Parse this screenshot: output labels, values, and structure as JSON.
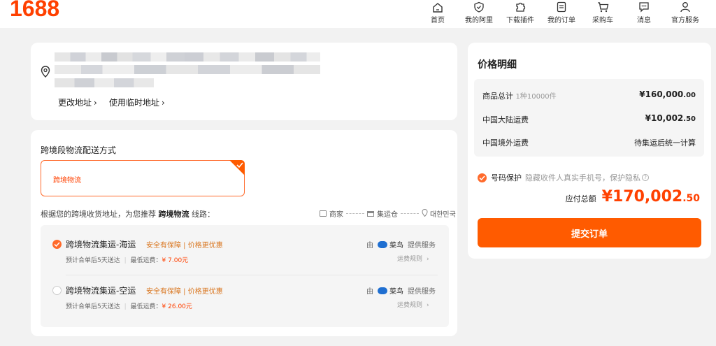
{
  "brand": {
    "logo": "1688",
    "accent": "#ff4000"
  },
  "nav": [
    {
      "label": "首页",
      "icon": "home-icon"
    },
    {
      "label": "我的阿里",
      "icon": "shield-heart-icon"
    },
    {
      "label": "下载插件",
      "icon": "puzzle-icon"
    },
    {
      "label": "我的订单",
      "icon": "order-list-icon"
    },
    {
      "label": "采购车",
      "icon": "cart-icon"
    },
    {
      "label": "消息",
      "icon": "chat-bubble-icon"
    },
    {
      "label": "官方服务",
      "icon": "user-icon"
    }
  ],
  "address": {
    "change_label": "更改地址",
    "temp_label": "使用临时地址"
  },
  "shipping": {
    "section_title": "跨境段物流配送方式",
    "selected_option": "跨境物流",
    "recommend_prefix": "根据您的跨境收货地址，为您推荐",
    "recommend_highlight": "跨境物流",
    "recommend_suffix": "线路：",
    "route": {
      "merchant": "商家",
      "warehouse": "集运仓",
      "destination": "대한민국"
    },
    "lines": [
      {
        "title": "跨境物流集运-海运",
        "tag": "安全有保障 | 价格更优惠",
        "eta": "预计合单后5天送达",
        "min_fee_label": "最低运费：",
        "min_fee": "¥ 7.00元",
        "by": "由",
        "carrier": "菜鸟",
        "service": "提供服务",
        "rules": "运费规则",
        "selected": true
      },
      {
        "title": "跨境物流集运-空运",
        "tag": "安全有保障 | 价格更优惠",
        "eta": "预计合单后5天送达",
        "min_fee_label": "最低运费：",
        "min_fee": "¥ 26.00元",
        "by": "由",
        "carrier": "菜鸟",
        "service": "提供服务",
        "rules": "运费规则",
        "selected": false
      }
    ]
  },
  "summary": {
    "title": "价格明细",
    "goods_label": "商品总计",
    "goods_count": "1种10000件",
    "goods_total_main": "¥160,000",
    "goods_total_dec": ".00",
    "cn_ship_label": "中国大陆运费",
    "cn_ship_main": "¥10,002",
    "cn_ship_dec": ".50",
    "intl_ship_label": "中国境外运费",
    "intl_ship_value": "待集运后统一计算",
    "privacy_label": "号码保护",
    "privacy_desc": "隐藏收件人真实手机号，保护隐私",
    "total_label": "应付总额",
    "total_main": "¥170,002",
    "total_dec": ".50",
    "submit_label": "提交订单"
  }
}
